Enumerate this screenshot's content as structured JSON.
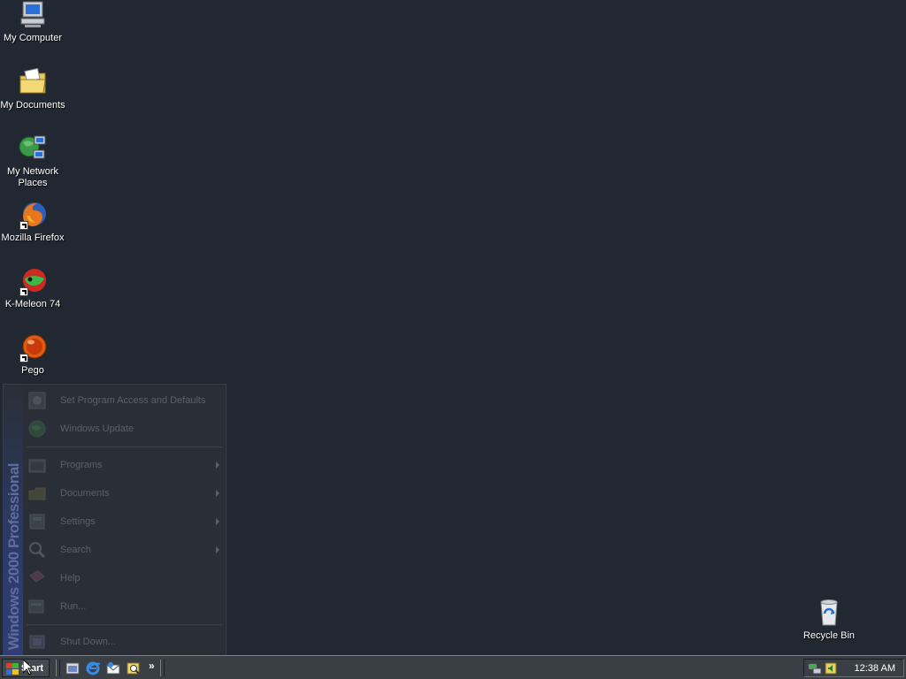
{
  "desktop": {
    "icons": [
      {
        "label": "My Computer"
      },
      {
        "label": "My Documents"
      },
      {
        "label": "My Network Places"
      },
      {
        "label": "Mozilla Firefox"
      },
      {
        "label": "K-Meleon 74"
      },
      {
        "label": "Pego"
      },
      {
        "label": "Recycle Bin"
      }
    ]
  },
  "start_menu": {
    "banner": "Windows 2000 Professional",
    "top_items": [
      {
        "label": "Set Program Access and Defaults"
      },
      {
        "label": "Windows Update"
      }
    ],
    "items": [
      {
        "label": "Programs",
        "submenu": true
      },
      {
        "label": "Documents",
        "submenu": true
      },
      {
        "label": "Settings",
        "submenu": true
      },
      {
        "label": "Search",
        "submenu": true
      },
      {
        "label": "Help",
        "submenu": false
      },
      {
        "label": "Run...",
        "submenu": false
      }
    ],
    "shutdown": {
      "label": "Shut Down..."
    }
  },
  "taskbar": {
    "start_label": "Start",
    "quick_launch": [
      "show-desktop-icon",
      "internet-explorer-icon",
      "outlook-express-icon",
      "search-icon"
    ],
    "overflow_label": "»",
    "tray_icons": [
      "network-icon",
      "volume-icon"
    ],
    "clock": "12:38 AM"
  },
  "colors": {
    "desktop": "#222831",
    "taskbar": "#3a3f45",
    "menu_text": "#5a606a"
  }
}
